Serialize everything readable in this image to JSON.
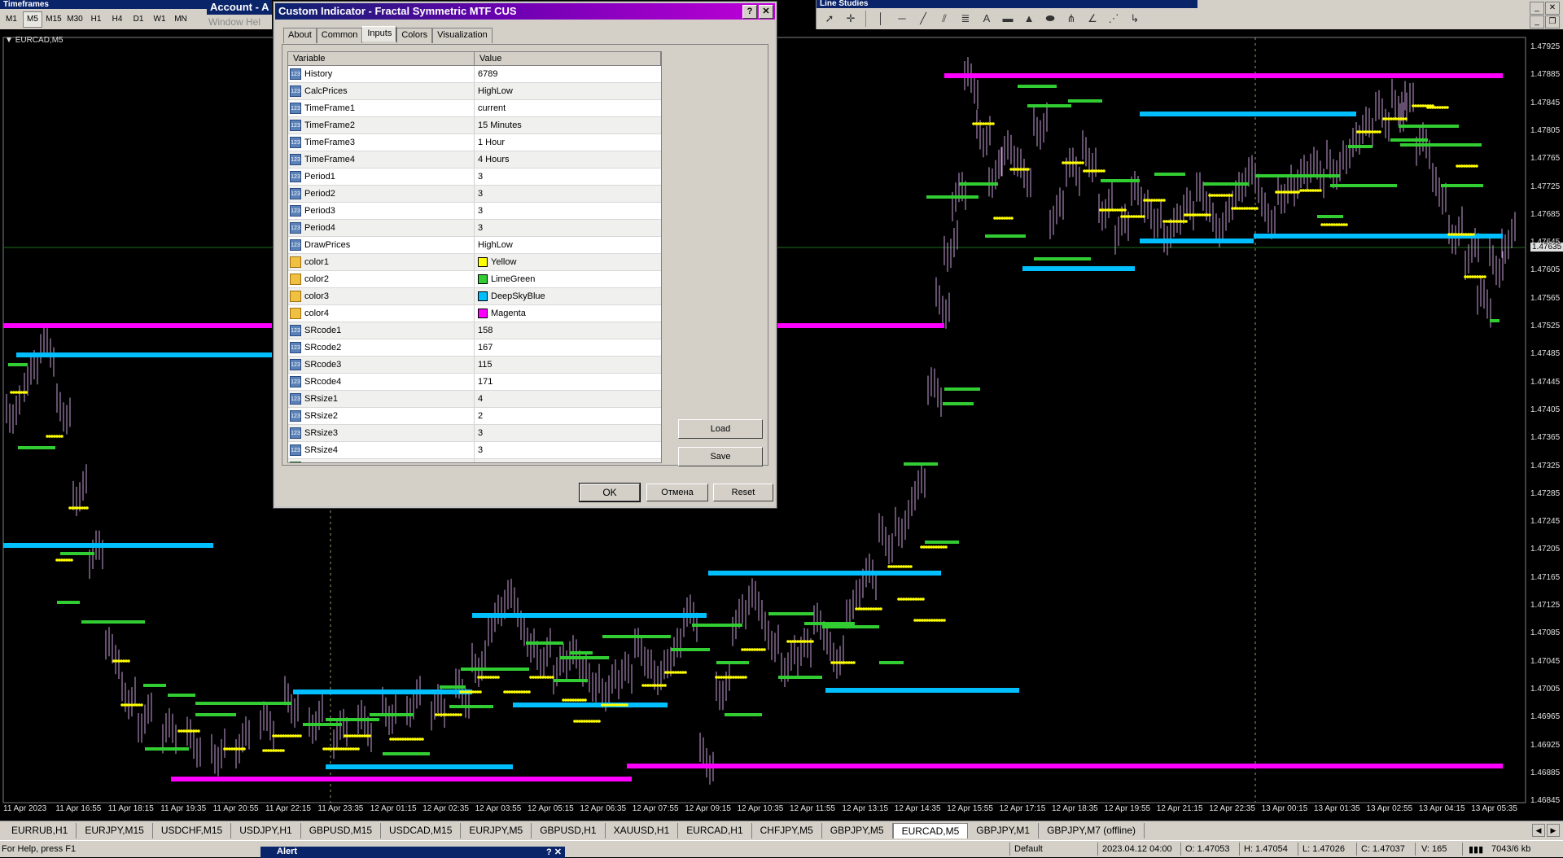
{
  "timeframes_panel": {
    "title": "Timeframes",
    "buttons": [
      "M1",
      "M5",
      "M15",
      "M30",
      "H1",
      "H4",
      "D1",
      "W1",
      "MN"
    ],
    "active": "M5"
  },
  "account_panel": {
    "title": "Account - A",
    "menu_text": "Window   Hel"
  },
  "line_studies": {
    "title": "Line Studies"
  },
  "chart": {
    "label": "EURCAD,M5",
    "current_price": "1.47635",
    "price_labels": [
      "1.47925",
      "1.47885",
      "1.47845",
      "1.47805",
      "1.47765",
      "1.47725",
      "1.47685",
      "1.47645",
      "1.47605",
      "1.47565",
      "1.47525",
      "1.47485",
      "1.47445",
      "1.47405",
      "1.47365",
      "1.47325",
      "1.47285",
      "1.47245",
      "1.47205",
      "1.47165",
      "1.47125",
      "1.47085",
      "1.47045",
      "1.47005",
      "1.46965",
      "1.46925",
      "1.46885",
      "1.46845"
    ],
    "time_labels": [
      "11 Apr 2023",
      "11 Apr 16:55",
      "11 Apr 18:15",
      "11 Apr 19:35",
      "11 Apr 20:55",
      "11 Apr 22:15",
      "11 Apr 23:35",
      "12 Apr 01:15",
      "12 Apr 02:35",
      "12 Apr 03:55",
      "12 Apr 05:15",
      "12 Apr 06:35",
      "12 Apr 07:55",
      "12 Apr 09:15",
      "12 Apr 10:35",
      "12 Apr 11:55",
      "12 Apr 13:15",
      "12 Apr 14:35",
      "12 Apr 15:55",
      "12 Apr 17:15",
      "12 Apr 18:35",
      "12 Apr 19:55",
      "12 Apr 21:15",
      "12 Apr 22:35",
      "13 Apr 00:15",
      "13 Apr 01:35",
      "13 Apr 02:55",
      "13 Apr 04:15",
      "13 Apr 05:35"
    ],
    "colors": {
      "yellow": "#ffff00",
      "green": "#32cd32",
      "blue": "#00bfff",
      "magenta": "#ff00ff",
      "candle": "#c8a0d8"
    }
  },
  "dialog": {
    "title": "Custom Indicator - Fractal Symmetric MTF CUS",
    "title_buttons": [
      "?",
      "✕"
    ],
    "tabs": [
      "About",
      "Common",
      "Inputs",
      "Colors",
      "Visualization"
    ],
    "active_tab": "Inputs",
    "columns": [
      "Variable",
      "Value"
    ],
    "rows": [
      {
        "name": "History",
        "value": "6789",
        "kind": "num"
      },
      {
        "name": "CalcPrices",
        "value": "HighLow",
        "kind": "num"
      },
      {
        "name": "TimeFrame1",
        "value": "current",
        "kind": "num"
      },
      {
        "name": "TimeFrame2",
        "value": "15 Minutes",
        "kind": "num"
      },
      {
        "name": "TimeFrame3",
        "value": "1 Hour",
        "kind": "num"
      },
      {
        "name": "TimeFrame4",
        "value": "4 Hours",
        "kind": "num"
      },
      {
        "name": "Period1",
        "value": "3",
        "kind": "num"
      },
      {
        "name": "Period2",
        "value": "3",
        "kind": "num"
      },
      {
        "name": "Period3",
        "value": "3",
        "kind": "num"
      },
      {
        "name": "Period4",
        "value": "3",
        "kind": "num"
      },
      {
        "name": "DrawPrices",
        "value": "HighLow",
        "kind": "num"
      },
      {
        "name": "color1",
        "value": "Yellow",
        "kind": "color",
        "swatch": "#ffff00"
      },
      {
        "name": "color2",
        "value": "LimeGreen",
        "kind": "color",
        "swatch": "#32cd32"
      },
      {
        "name": "color3",
        "value": "DeepSkyBlue",
        "kind": "color",
        "swatch": "#00bfff"
      },
      {
        "name": "color4",
        "value": "Magenta",
        "kind": "color",
        "swatch": "#ff00ff"
      },
      {
        "name": "SRcode1",
        "value": "158",
        "kind": "num"
      },
      {
        "name": "SRcode2",
        "value": "167",
        "kind": "num"
      },
      {
        "name": "SRcode3",
        "value": "115",
        "kind": "num"
      },
      {
        "name": "SRcode4",
        "value": "171",
        "kind": "num"
      },
      {
        "name": "SRsize1",
        "value": "4",
        "kind": "num"
      },
      {
        "name": "SRsize2",
        "value": "2",
        "kind": "num"
      },
      {
        "name": "SRsize3",
        "value": "3",
        "kind": "num"
      },
      {
        "name": "SRsize4",
        "value": "3",
        "kind": "num"
      },
      {
        "name": "ShowSupRes",
        "value": "true",
        "kind": "bool"
      }
    ],
    "icon_text": "123",
    "load_label": "Load",
    "save_label": "Save",
    "ok_label": "OK",
    "cancel_label": "Отмена",
    "reset_label": "Reset"
  },
  "symbol_tabs": [
    "EURRUB,H1",
    "EURJPY,M15",
    "USDCHF,M15",
    "USDJPY,H1",
    "GBPUSD,M15",
    "USDCAD,M15",
    "EURJPY,M5",
    "GBPUSD,H1",
    "XAUUSD,H1",
    "EURCAD,H1",
    "CHFJPY,M5",
    "GBPJPY,M5",
    "EURCAD,M5",
    "GBPJPY,M1",
    "GBPJPY,M7 (offline)"
  ],
  "active_symbol_tab": "EURCAD,M5",
  "status": {
    "help": "For Help, press F1",
    "profile": "Default",
    "datetime": "2023.04.12 04:00",
    "open": "O: 1.47053",
    "high": "H: 1.47054",
    "low": "L: 1.47026",
    "close": "C: 1.47037",
    "volume": "V: 165",
    "traffic": "7043/6 kb"
  },
  "alert_window": {
    "title": "Alert"
  }
}
